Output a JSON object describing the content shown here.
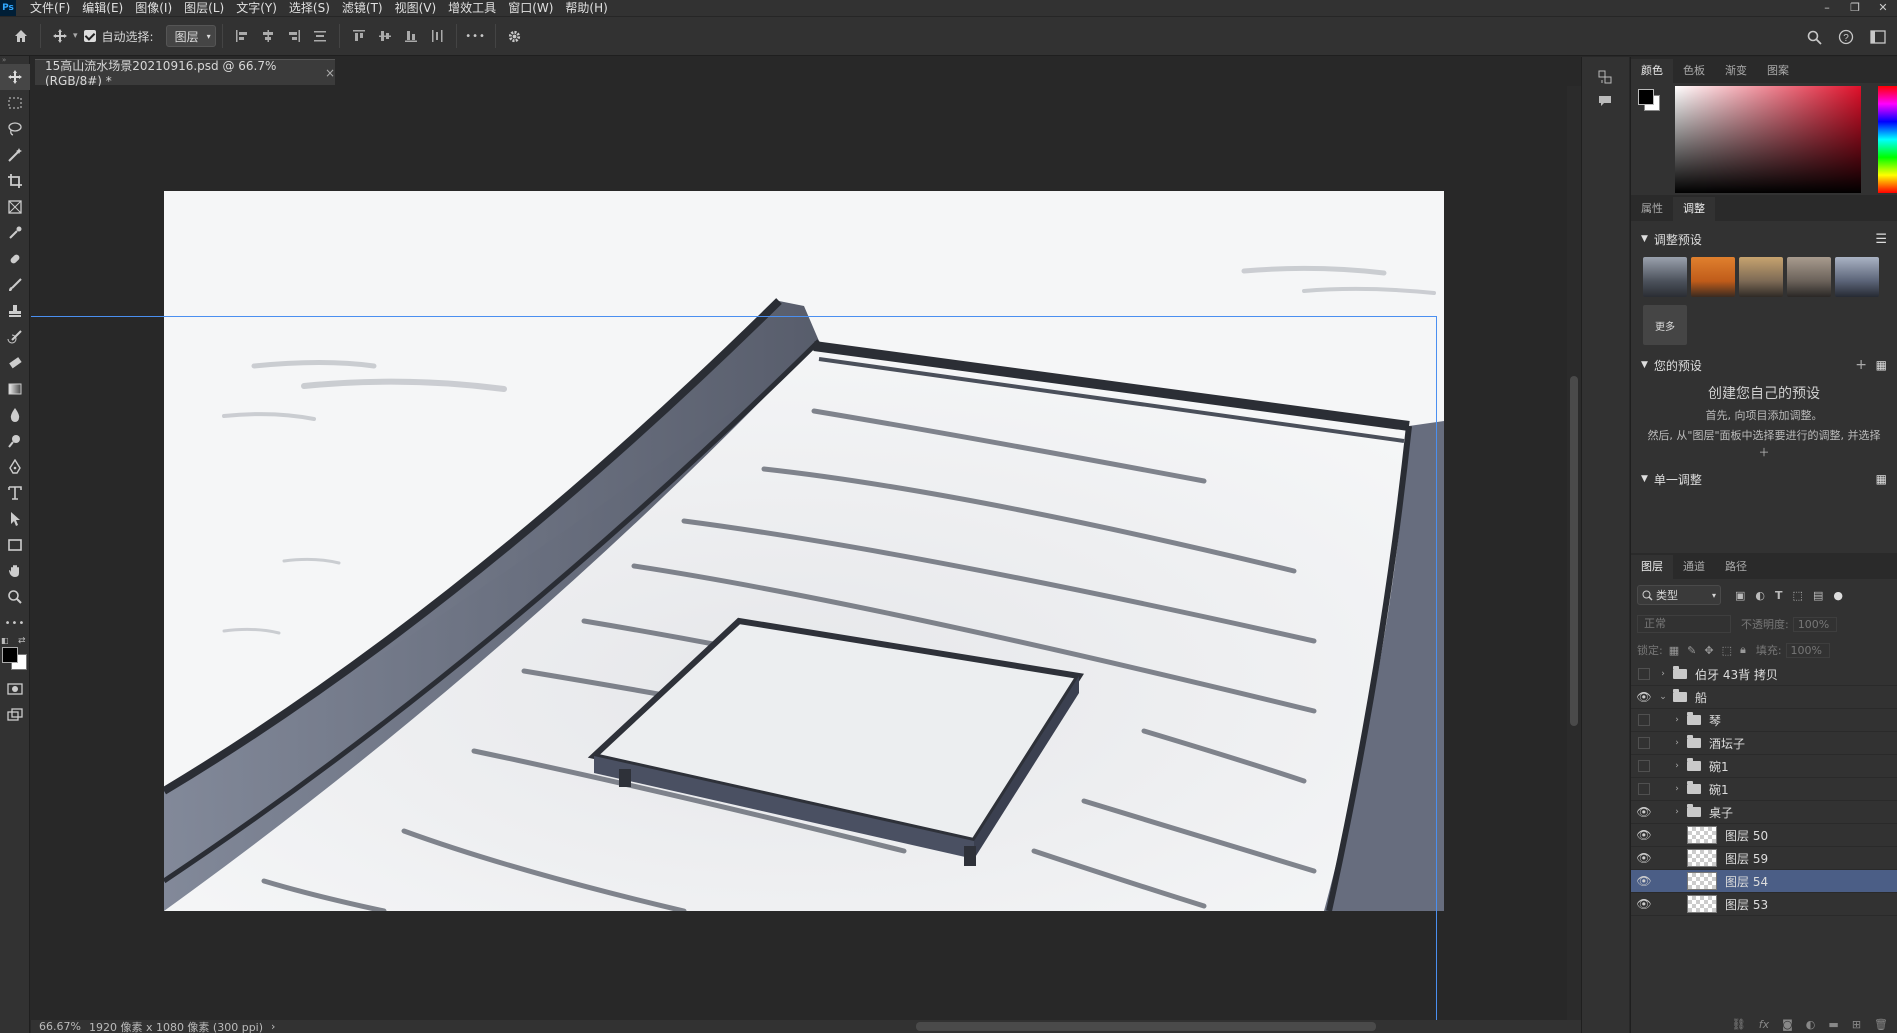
{
  "app": {
    "logo": "Ps"
  },
  "menu": [
    "文件(F)",
    "编辑(E)",
    "图像(I)",
    "图层(L)",
    "文字(Y)",
    "选择(S)",
    "滤镜(T)",
    "视图(V)",
    "增效工具",
    "窗口(W)",
    "帮助(H)"
  ],
  "window_controls": [
    "–",
    "❐",
    "✕"
  ],
  "options": {
    "auto_select_label": "自动选择:",
    "auto_select_target": "图层",
    "more": "•••"
  },
  "document": {
    "tab_title": "15高山流水场景20210916.psd @ 66.7%(RGB/8#) *",
    "close": "×"
  },
  "status": {
    "zoom": "66.67%",
    "info": "1920 像素 x 1080 像素 (300 ppi)",
    "arrow": "›"
  },
  "colors": {
    "accent_selection": "#4b5e86",
    "guide": "#4a8ff0",
    "foreground": "#000000",
    "background": "#ffffff"
  },
  "color_panel": {
    "tabs": [
      "颜色",
      "色板",
      "渐变",
      "图案"
    ]
  },
  "adjust_panel": {
    "tabs": [
      "属性",
      "调整"
    ],
    "presets_title": "调整预设",
    "more_label": "更多",
    "your_presets_title": "您的预设",
    "create_title": "创建您自己的预设",
    "create_line1": "首先, 向项目添加调整。",
    "create_line2": "然后, 从\"图层\"面板中选择要进行的调整, 并选择 ＋",
    "single_title": "单一调整"
  },
  "layers_panel": {
    "tabs": [
      "图层",
      "通道",
      "路径"
    ],
    "filter_label": "类型",
    "blend_mode": "正常",
    "opacity_label": "不透明度:",
    "opacity_value": "100%",
    "lock_label": "锁定:",
    "fill_label": "填充:",
    "fill_value": "100%",
    "layers": [
      {
        "name": "伯牙 43背 拷贝",
        "type": "group",
        "visible": false,
        "indent": 0
      },
      {
        "name": "船",
        "type": "group-open",
        "visible": true,
        "indent": 0
      },
      {
        "name": "琴",
        "type": "group",
        "visible": false,
        "indent": 1
      },
      {
        "name": "酒坛子",
        "type": "group",
        "visible": false,
        "indent": 1
      },
      {
        "name": "碗1",
        "type": "group",
        "visible": false,
        "indent": 1
      },
      {
        "name": "碗1",
        "type": "group",
        "visible": false,
        "indent": 1
      },
      {
        "name": "桌子",
        "type": "group",
        "visible": true,
        "indent": 1
      },
      {
        "name": "图层 50",
        "type": "layer",
        "visible": true,
        "indent": 1
      },
      {
        "name": "图层 59",
        "type": "layer",
        "visible": true,
        "indent": 1
      },
      {
        "name": "图层 54",
        "type": "layer",
        "visible": true,
        "indent": 1,
        "selected": true
      },
      {
        "name": "图层 53",
        "type": "layer",
        "visible": true,
        "indent": 1
      }
    ]
  }
}
